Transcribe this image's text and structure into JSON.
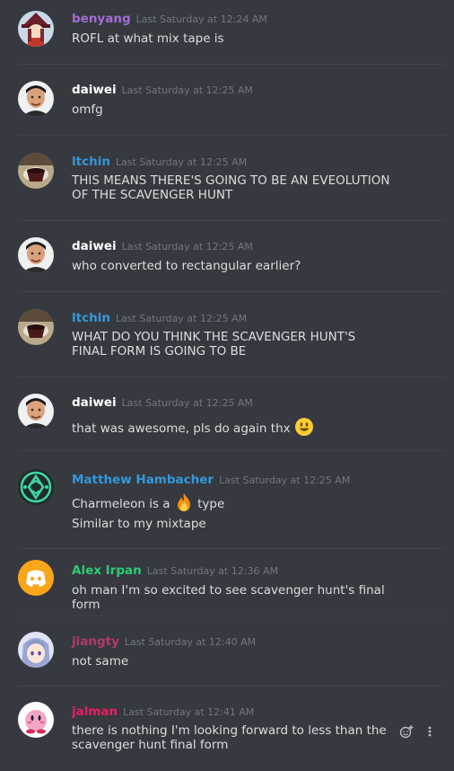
{
  "messages": [
    {
      "author": "benyang",
      "time": "Last Saturday at 12:24 AM",
      "lines": [
        "ROFL at what mix tape is"
      ],
      "color": "#a36cd6"
    },
    {
      "author": "daiwei",
      "time": "Last Saturday at 12:25 AM",
      "lines": [
        "omfg"
      ],
      "color": "#ffffff"
    },
    {
      "author": "ltchin",
      "time": "Last Saturday at 12:25 AM",
      "lines": [
        "THIS MEANS THERE'S GOING TO BE AN EVEOLUTION",
        "OF THE SCAVENGER HUNT"
      ],
      "color": "#3498db"
    },
    {
      "author": "daiwei",
      "time": "Last Saturday at 12:25 AM",
      "lines": [
        "who converted to rectangular earlier?"
      ],
      "color": "#ffffff"
    },
    {
      "author": "ltchin",
      "time": "Last Saturday at 12:25 AM",
      "lines": [
        "WHAT DO YOU THINK THE SCAVENGER HUNT'S",
        "FINAL FORM IS GOING TO BE"
      ],
      "color": "#3498db"
    },
    {
      "author": "daiwei",
      "time": "Last Saturday at 12:25 AM",
      "lines": [
        "that was awesome, pls do again thx"
      ],
      "emoji": "smiley-emoji",
      "color": "#ffffff"
    },
    {
      "author": "Matthew Hambacher",
      "time": "Last Saturday at 12:25 AM",
      "line1_before": "Charmeleon is a",
      "emoji": "fire-emoji",
      "line1_after": "type",
      "line2": "Similar to my mixtape",
      "color": "#3498db"
    },
    {
      "author": "Alex Irpan",
      "time": "Last Saturday at 12:36 AM",
      "lines": [
        "oh man I'm so excited to see scavenger hunt's final form"
      ],
      "color": "#2ecc71"
    },
    {
      "author": "jiangty",
      "time": "Last Saturday at 12:40 AM",
      "lines": [
        "not same"
      ],
      "color": "#b03a6b"
    },
    {
      "author": "jalman",
      "time": "Last Saturday at 12:41 AM",
      "lines": [
        "there is nothing I'm looking forward to less than the",
        "scavenger hunt final form"
      ],
      "color": "#e91e63"
    }
  ],
  "icons": {
    "reaction": "add-reaction-icon",
    "more": "more-options-icon"
  }
}
